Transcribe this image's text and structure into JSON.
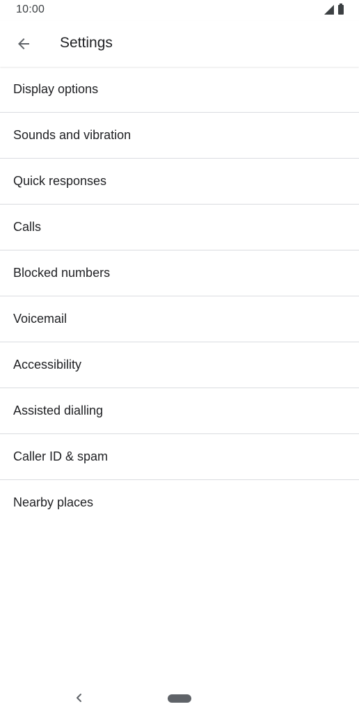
{
  "status_bar": {
    "time": "10:00",
    "icons": [
      "signal-icon",
      "battery-icon"
    ]
  },
  "app_bar": {
    "back_icon": "arrow-back-icon",
    "title": "Settings"
  },
  "settings": {
    "items": [
      {
        "label": "Display options"
      },
      {
        "label": "Sounds and vibration"
      },
      {
        "label": "Quick responses"
      },
      {
        "label": "Calls"
      },
      {
        "label": "Blocked numbers"
      },
      {
        "label": "Voicemail"
      },
      {
        "label": "Accessibility"
      },
      {
        "label": "Assisted dialling"
      },
      {
        "label": "Caller ID & spam"
      },
      {
        "label": "Nearby places"
      }
    ]
  },
  "nav_bar": {
    "back_icon": "nav-back-icon",
    "home_icon": "home-pill-icon"
  },
  "colors": {
    "background": "#ffffff",
    "text_primary": "#202124",
    "divider": "#dadce0",
    "icon": "#5f6368"
  }
}
